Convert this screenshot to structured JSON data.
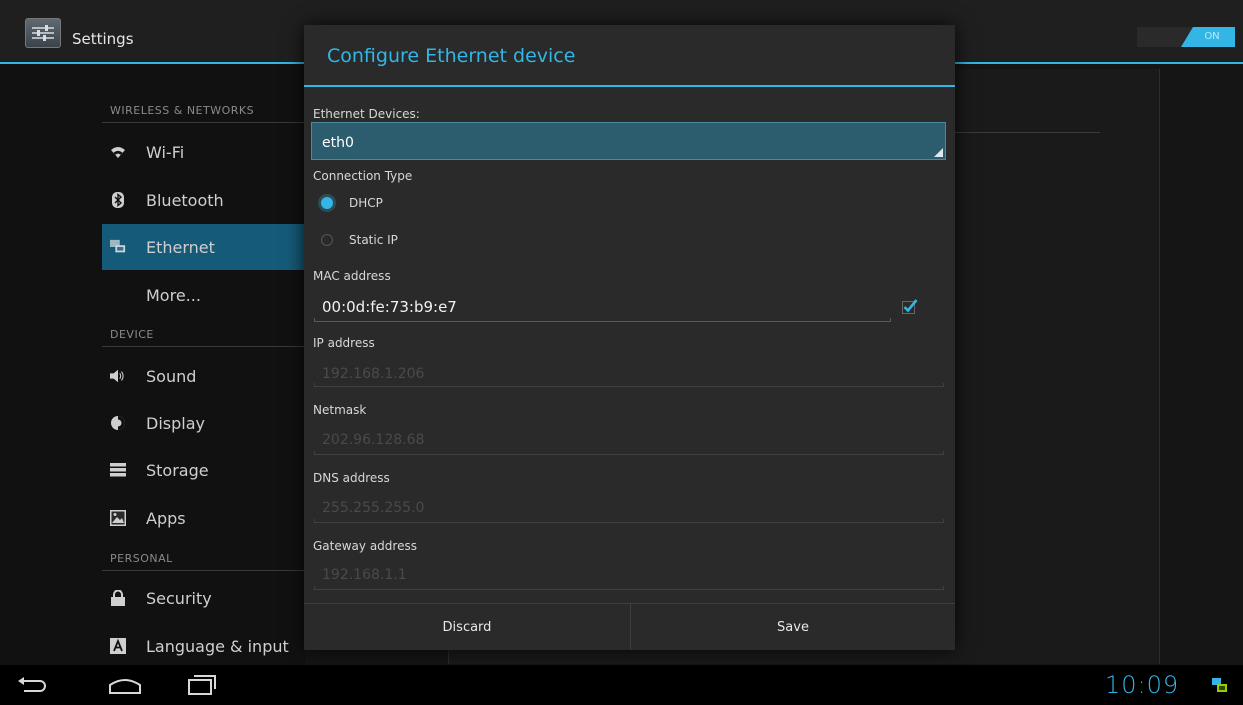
{
  "actionbar": {
    "title": "Settings",
    "toggle_label": "ON"
  },
  "sidebar": {
    "sections": [
      {
        "header": "WIRELESS & NETWORKS"
      },
      {
        "header": "DEVICE"
      },
      {
        "header": "PERSONAL"
      }
    ],
    "items": [
      {
        "label": "Wi-Fi",
        "icon": "wifi-icon"
      },
      {
        "label": "Bluetooth",
        "icon": "bluetooth-icon"
      },
      {
        "label": "Ethernet",
        "icon": "ethernet-icon",
        "selected": true
      },
      {
        "label": "More..."
      },
      {
        "label": "Sound",
        "icon": "sound-icon"
      },
      {
        "label": "Display",
        "icon": "display-icon"
      },
      {
        "label": "Storage",
        "icon": "storage-icon"
      },
      {
        "label": "Apps",
        "icon": "apps-icon"
      },
      {
        "label": "Security",
        "icon": "lock-icon"
      },
      {
        "label": "Language & input",
        "icon": "language-icon"
      }
    ]
  },
  "dialog": {
    "title": "Configure Ethernet device",
    "devices_label": "Ethernet Devices:",
    "device_value": "eth0",
    "connection_type_label": "Connection Type",
    "connection_options": [
      {
        "label": "DHCP",
        "checked": true
      },
      {
        "label": "Static IP",
        "checked": false
      }
    ],
    "mac_label": "MAC address",
    "mac_value": "00:0d:fe:73:b9:e7",
    "mac_checked": true,
    "ip_label": "IP address",
    "ip_value": "192.168.1.206",
    "netmask_label": "Netmask",
    "netmask_value": "202.96.128.68",
    "dns_label": "DNS address",
    "dns_value": "255.255.255.0",
    "gateway_label": "Gateway address",
    "gateway_value": "192.168.1.1",
    "discard_label": "Discard",
    "save_label": "Save"
  },
  "navbar": {
    "clock": "10:09"
  },
  "colors": {
    "accent": "#33b5e5",
    "selected": "#155b79"
  }
}
